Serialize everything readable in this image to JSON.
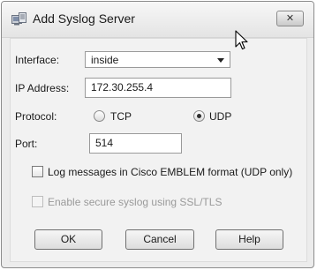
{
  "dialog": {
    "title": "Add Syslog Server",
    "close_glyph": "✕"
  },
  "form": {
    "interface": {
      "label": "Interface:",
      "value": "inside"
    },
    "ip_address": {
      "label": "IP Address:",
      "value": "172.30.255.4"
    },
    "protocol": {
      "label": "Protocol:",
      "options": [
        "TCP",
        "UDP"
      ],
      "selected": "UDP"
    },
    "port": {
      "label": "Port:",
      "value": "514"
    },
    "emblem": {
      "label": "Log messages in Cisco EMBLEM format (UDP only)",
      "checked": false
    },
    "secure": {
      "label": "Enable secure syslog using SSL/TLS",
      "checked": false,
      "disabled": true
    }
  },
  "buttons": {
    "ok": "OK",
    "cancel": "Cancel",
    "help": "Help"
  }
}
